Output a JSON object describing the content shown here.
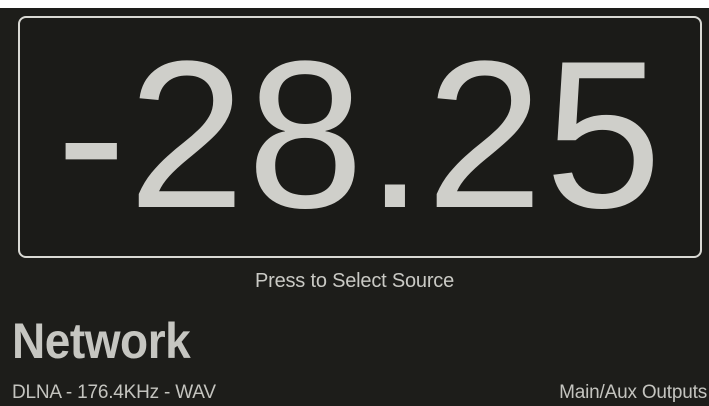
{
  "volume": {
    "display": "-28.25"
  },
  "source_selector": {
    "hint": "Press to Select Source"
  },
  "source": {
    "name": "Network",
    "stream_info": "DLNA - 176.4KHz - WAV"
  },
  "outputs": {
    "label": "Main/Aux Outputs"
  },
  "colors": {
    "background": "#1d1d1a",
    "text": "#c9c9c4",
    "border": "#d9d9d4"
  }
}
